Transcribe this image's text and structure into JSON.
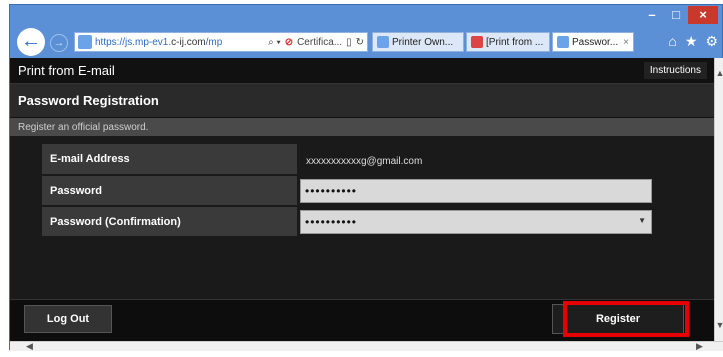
{
  "browser": {
    "address_url": "https://js.mp-ev1.c-ij.com/mp",
    "address_url_prefix": "https://js.mp-ev1.",
    "address_url_domain": "c-ij.com",
    "address_url_suffix": "/mp",
    "address_search_glyph": "⌕ ▾",
    "certificate_label": "Certifica...",
    "tabs": [
      {
        "label": "Printer Own...",
        "color": "#6aa3e8"
      },
      {
        "label": "[Print from ...",
        "color": "#d44"
      },
      {
        "label": "Passwor...",
        "color": "#6aa3e8",
        "active": true
      }
    ],
    "tab_close": "×",
    "caption": {
      "minimize": "–",
      "maximize": "□",
      "close": "×"
    },
    "nav": {
      "back": "←",
      "forward": "→"
    },
    "toolbar_icons": {
      "home": "⌂",
      "favorites": "★",
      "settings": "⚙"
    }
  },
  "header": {
    "title": "Print from E-mail",
    "instructions_label": "Instructions"
  },
  "section": {
    "title": "Password Registration",
    "description": "Register an official password."
  },
  "form": {
    "email_label": "E-mail Address",
    "email_value": "xxxxxxxxxxxg@gmail.com",
    "password_label": "Password",
    "password_value": "••••••••••",
    "confirm_label": "Password (Confirmation)",
    "confirm_value": "••••••••••",
    "confirm_dropdown_glyph": "▼"
  },
  "footer": {
    "logout_label": "Log Out",
    "register_label": "Register"
  },
  "scrollbars": {
    "up": "▲",
    "down": "▼",
    "left": "◀",
    "right": "▶"
  },
  "colors": {
    "highlight": "#e60000",
    "chrome": "#5b8fd6",
    "page_bg": "#1a1a1a"
  }
}
